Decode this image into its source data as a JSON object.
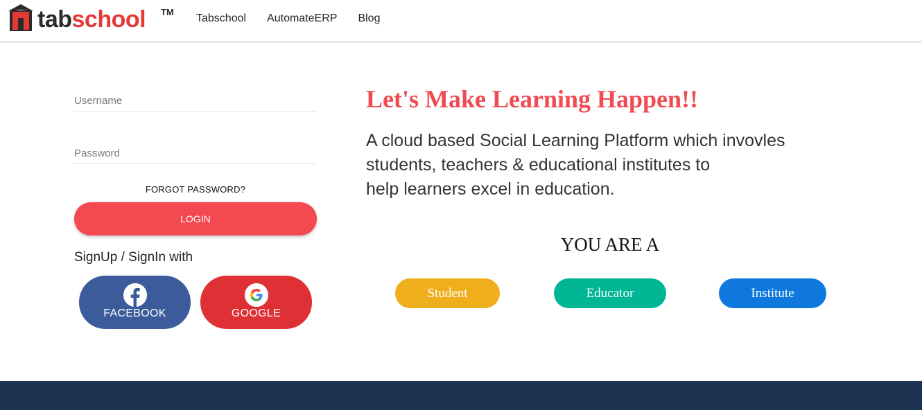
{
  "header": {
    "logo": {
      "tab": "tab",
      "school": "school",
      "tm": "TM"
    },
    "nav": [
      {
        "label": "Tabschool"
      },
      {
        "label": "AutomateERP"
      },
      {
        "label": "Blog"
      }
    ]
  },
  "login": {
    "username_placeholder": "Username",
    "password_placeholder": "Password",
    "forgot_label": "FORGOT PASSWORD?",
    "login_label": "LOGIN",
    "signup_label": "SignUp / SignIn with",
    "facebook_label": "FACEBOOK",
    "google_label": "GOOGLE"
  },
  "hero": {
    "headline": "Let's Make Learning Happen!!",
    "description_lines": [
      "A cloud based Social Learning Platform which invovles",
      "students, teachers & educational institutes to",
      "help learners excel in education."
    ],
    "you_are": "YOU ARE A",
    "roles": [
      {
        "label": "Student"
      },
      {
        "label": "Educator"
      },
      {
        "label": "Institute"
      }
    ]
  },
  "colors": {
    "accent": "#f44950",
    "logo_red": "#e53935",
    "facebook": "#3b5b9b",
    "google": "#de3035",
    "student": "#efaf1d",
    "educator": "#01b695",
    "institute": "#0f78de",
    "footer": "#1c3451"
  }
}
